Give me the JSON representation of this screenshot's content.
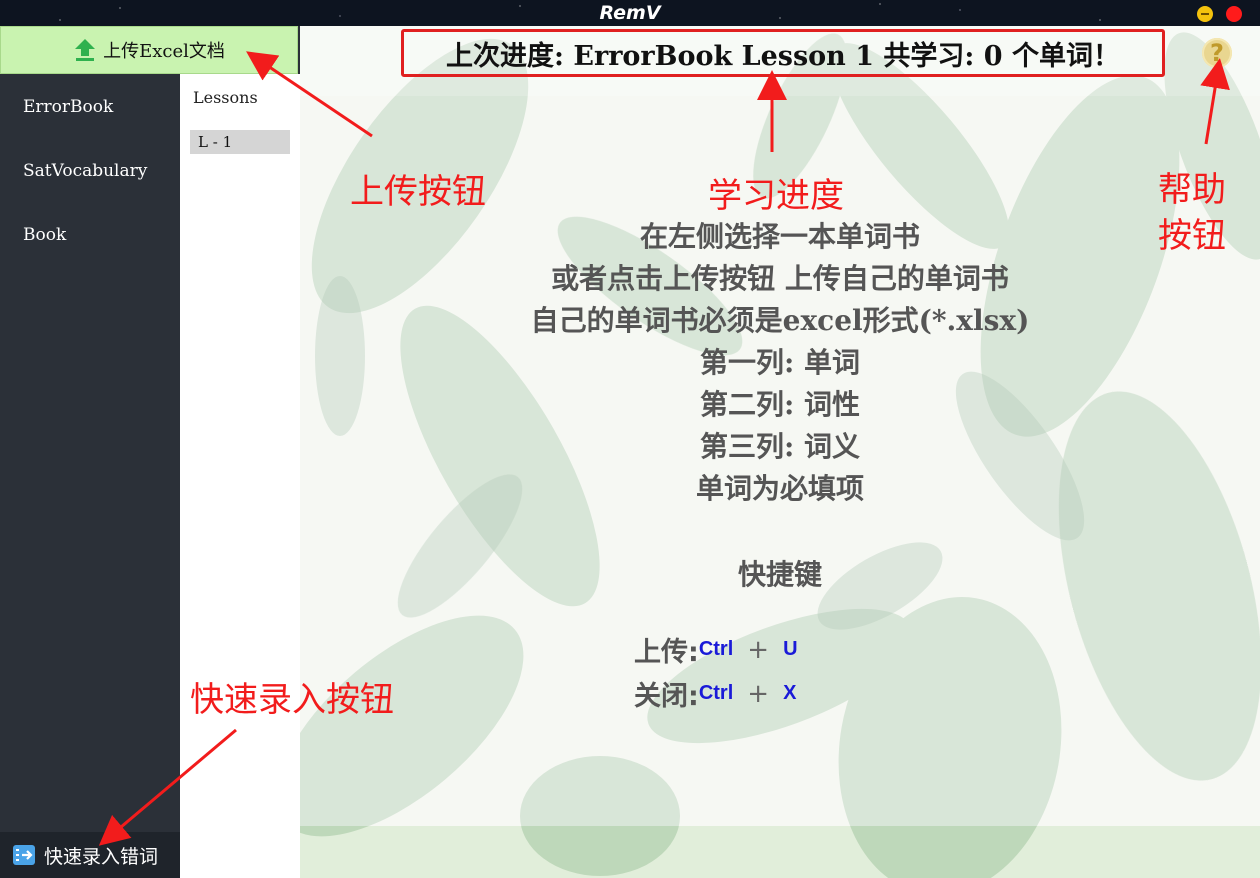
{
  "window": {
    "title": "RemV"
  },
  "sidebar": {
    "upload_button": "上传Excel文档",
    "books": [
      "ErrorBook",
      "SatVocabulary",
      "Book"
    ],
    "quick_entry_button": "快速录入错词"
  },
  "lessons_panel": {
    "title": "Lessons",
    "items": [
      "L - 1"
    ]
  },
  "header": {
    "progress_text": "上次进度: ErrorBook Lesson 1  共学习: 0 个单词！",
    "help_symbol": "?"
  },
  "instructions": [
    "在左侧选择一本单词书",
    "或者点击上传按钮 上传自己的单词书",
    "自己的单词书必须是excel形式(*.xlsx)",
    "第一列: 单词",
    "第二列: 词性",
    "第三列: 词义",
    "单词为必填项"
  ],
  "shortcuts": {
    "title": "快捷键",
    "upload_label": "上传:",
    "close_label": "关闭:",
    "ctrl": "Ctrl",
    "plus": "+",
    "upload_key": "U",
    "close_key": "X"
  },
  "annotations": {
    "upload": "上传按钮",
    "progress": "学习进度",
    "help_line1": "帮助",
    "help_line2": "按钮",
    "quick_entry": "快速录入按钮"
  },
  "colors": {
    "annotation_red": "#f21c1c",
    "upload_green": "#c9f3b0",
    "shortcut_key_blue": "#1a1ad8",
    "sidebar_dark": "#2b3038"
  }
}
